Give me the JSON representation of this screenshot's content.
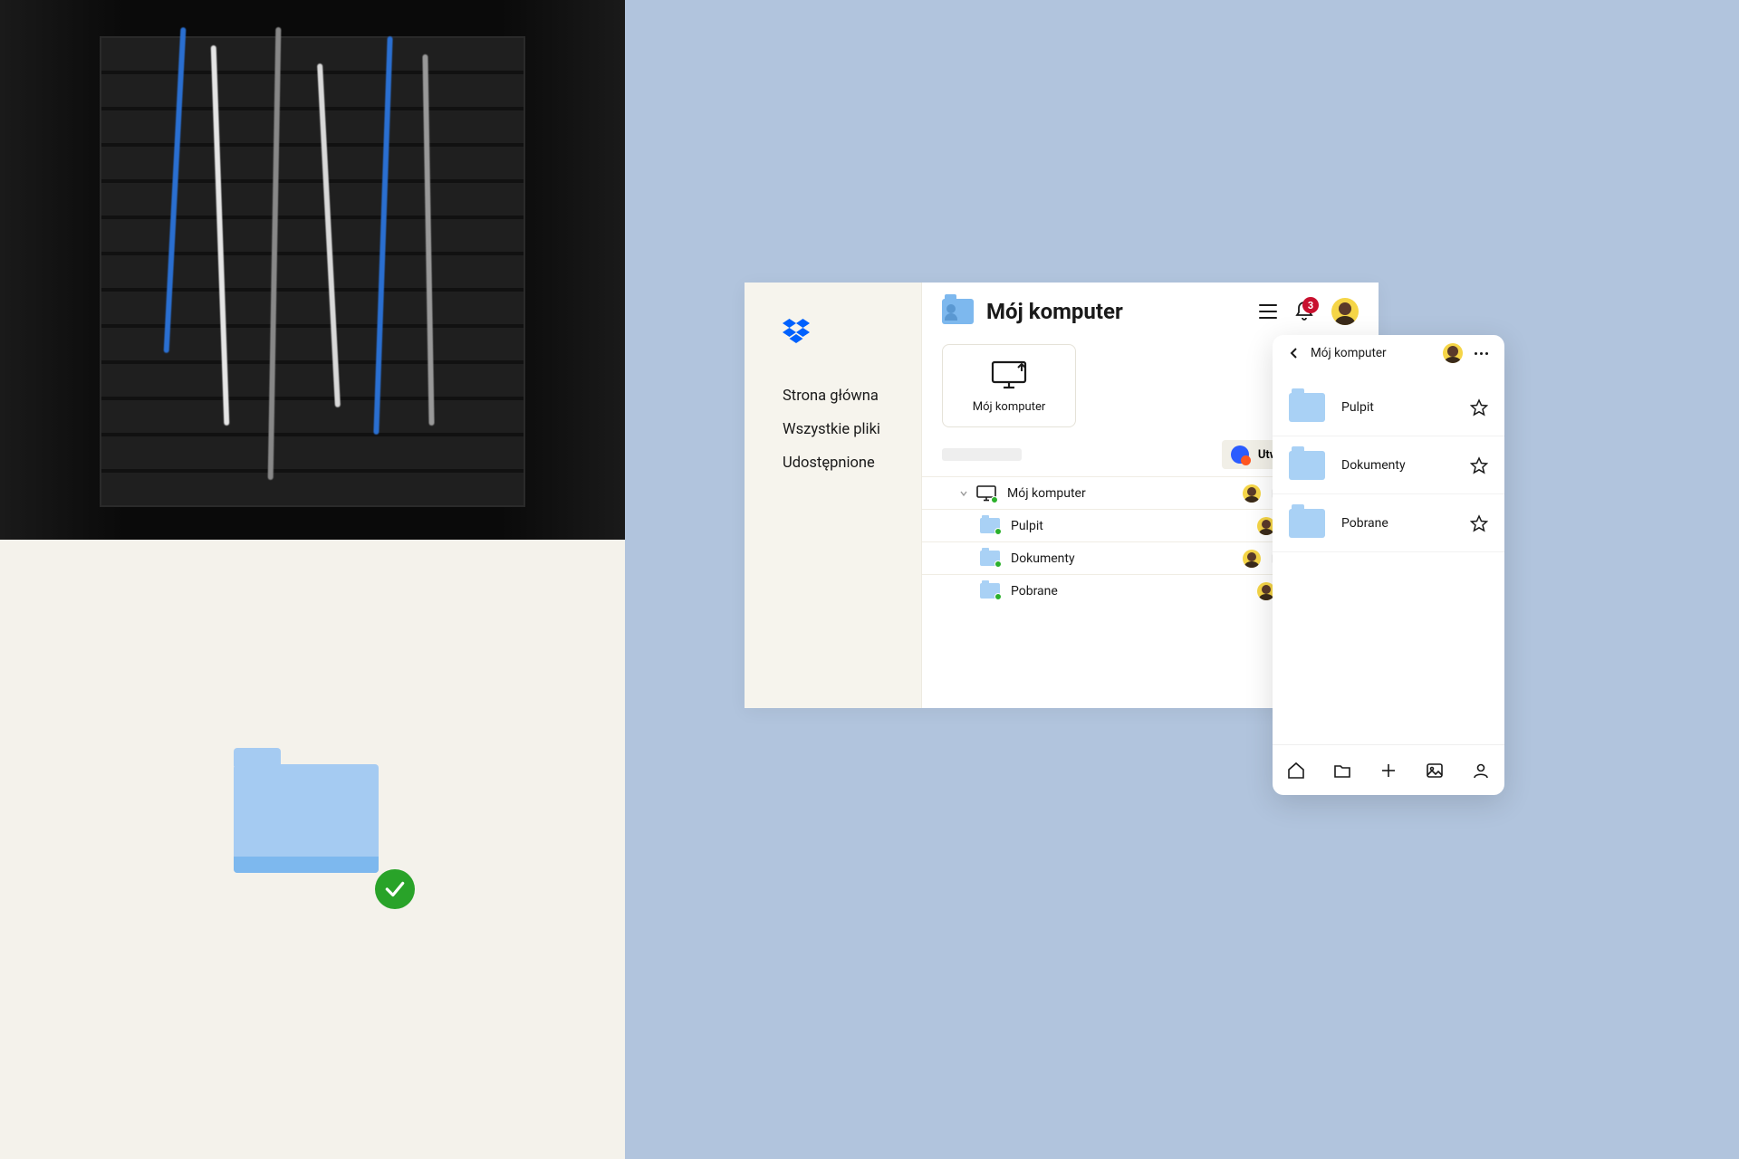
{
  "colors": {
    "canvas_blue": "#b1c4dd",
    "folder_blue": "#a5cbf2",
    "folder_dark": "#7db8ee",
    "check_green": "#29a329",
    "badge_red": "#c8102e",
    "sidebar_bg": "#f6f4ed"
  },
  "desktop": {
    "title": "Mój komputer",
    "nav": {
      "home": "Strona główna",
      "all_files": "Wszystkie pliki",
      "shared": "Udostępnione"
    },
    "notifications": "3",
    "card_label": "Mój komputer",
    "create_label": "Utwórz",
    "rows": [
      {
        "name": "Mój komputer",
        "type": "computer"
      },
      {
        "name": "Pulpit",
        "type": "folder"
      },
      {
        "name": "Dokumenty",
        "type": "folder"
      },
      {
        "name": "Pobrane",
        "type": "folder"
      }
    ]
  },
  "mobile": {
    "title": "Mój komputer",
    "items": [
      {
        "name": "Pulpit"
      },
      {
        "name": "Dokumenty"
      },
      {
        "name": "Pobrane"
      }
    ]
  },
  "icons": {
    "logo": "dropbox-logo",
    "hamburger": "hamburger-icon",
    "bell": "bell-icon",
    "avatar": "user-avatar",
    "computer_upload": "computer-upload-icon",
    "chevron_down": "chevron-down-icon",
    "folder_open": "folder-open-icon",
    "star": "star-icon",
    "back": "chevron-left-icon",
    "more": "more-icon",
    "home": "home-icon",
    "folder": "folder-icon",
    "plus": "plus-icon",
    "photo": "photo-icon",
    "person": "person-icon",
    "check": "check-icon"
  }
}
